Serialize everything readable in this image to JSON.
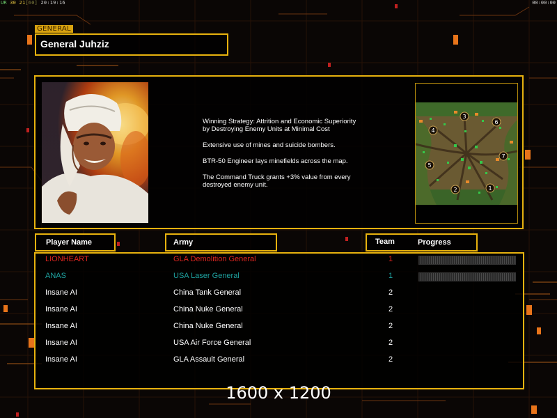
{
  "status_bar": {
    "fps_label": "UR",
    "fps_value": "30",
    "fps_mid": "21",
    "fps_limit": "[60]",
    "clock": "20:19:16",
    "elapsed": "00:00:00"
  },
  "general": {
    "tag": "GENERAL",
    "name": "General Juhziz"
  },
  "description": {
    "paragraphs": [
      "Winning Strategy: Attrition and Economic Superiority\n by Destroying Enemy Units at Minimal Cost",
      "Extensive use of mines and suicide bombers.",
      "BTR-50 Engineer lays minefields across the map.",
      "The Command Truck grants +3% value from every\n destroyed enemy unit."
    ]
  },
  "minimap": {
    "start_positions": [
      "1",
      "2",
      "3",
      "4",
      "5",
      "6",
      "7"
    ]
  },
  "table": {
    "headers": {
      "player": "Player Name",
      "army": "Army",
      "team": "Team",
      "progress": "Progress"
    },
    "rows": [
      {
        "player": "LIONHEART",
        "army": "GLA Demolition General",
        "team": "1",
        "color": "#e0251f",
        "progress": 0.0
      },
      {
        "player": "ANAS",
        "army": "USA Laser General",
        "team": "1",
        "color": "#1fa3a0",
        "progress": 0.0
      },
      {
        "player": "Insane AI",
        "army": "China Tank General",
        "team": "2",
        "color": "#ffffff"
      },
      {
        "player": "Insane AI",
        "army": "China Nuke General",
        "team": "2",
        "color": "#ffffff"
      },
      {
        "player": "Insane AI",
        "army": "China Nuke General",
        "team": "2",
        "color": "#ffffff"
      },
      {
        "player": "Insane AI",
        "army": "USA Air Force General",
        "team": "2",
        "color": "#ffffff"
      },
      {
        "player": "Insane AI",
        "army": "GLA Assault General",
        "team": "2",
        "color": "#ffffff"
      }
    ]
  },
  "resolution_label": "1600 x 1200",
  "colors": {
    "accent": "#e8b20e",
    "background": "#0a0605",
    "decor_orange": "#e8741a"
  }
}
